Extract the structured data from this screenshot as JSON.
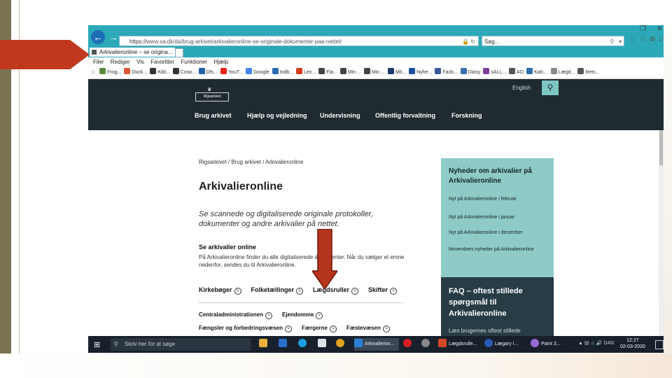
{
  "browser": {
    "url_protocol": "https://",
    "url_rest": "www.sa.dk/da/brug-arkivet/arkivalieronline-se-originale-dokumenter-paa-nettet/",
    "search_placeholder": "Søg...",
    "tab_title": "Arkivalieronline – se origina...",
    "menu": [
      "Filer",
      "Rediger",
      "Vis",
      "Favoritter",
      "Funktioner",
      "Hjælp"
    ],
    "favorites": [
      "Frog...",
      "Duck...",
      "Kild...",
      "Crow...",
      "Dfs...",
      "YouT...",
      "Google",
      "Indb...",
      "Lex...",
      "Fla...",
      "Min ...",
      "Min ...",
      "Mit...",
      "Nyhe...",
      "Facb...",
      "Daisy",
      "sALL...",
      "AO",
      "Kalc...",
      "Lægd...",
      "Rets..."
    ],
    "favorite_colors": [
      "#5a8a3a",
      "#de5833",
      "#333333",
      "#333333",
      "#1f5fa8",
      "#e62117",
      "#4285f4",
      "#2a6ab3",
      "#d83b1d",
      "#444444",
      "#444444",
      "#444444",
      "#1a3a6b",
      "#1d4ea3",
      "#3b5998",
      "#3a6fb0",
      "#7f3fa0",
      "#555555",
      "#2a6fb0",
      "#888888",
      "#555555"
    ]
  },
  "site": {
    "logo_text": "Rigsarkivet",
    "lang_link": "English",
    "nav": [
      "Brug arkivet",
      "Hjælp og vejledning",
      "Undervisning",
      "Offentlig forvaltning",
      "Forskning"
    ],
    "breadcrumb": "Rigsarkivet  /  Brug arkivet  /  Arkivalieronline",
    "title": "Arkivalieronline",
    "lead": "Se scannede og digitaliserede originale protokoller, dokumenter og andre arkivalier på nettet.",
    "section_heading": "Se arkivalier online",
    "section_text": "På Arkivalieronline finder du alle digitaliserede dokumenter. Når du vælger et emne nedenfor, sendes du til Arkivalieronline.",
    "links_row1": [
      "Kirkebøger",
      "Folketællinger",
      "Lægdsruller",
      "Skifter"
    ],
    "links_row2": [
      "Centraladministrationen",
      "Ejendomme"
    ],
    "links_row3": [
      "Fængsler og forbedringsvæsen",
      "Færgerne",
      "Fæstevæsen"
    ],
    "news_heading": "Nyheder om arkivalier på Arkivalieronline",
    "news_items": [
      "Nyt på Arkivalieronline i februar",
      "Nyt på Arkivalieronline i januar",
      "Nyt på Arkivalieronline i december",
      "Novembers nyheder på Arkivalieronline"
    ],
    "faq_heading": "FAQ – oftest stillede spørgsmål til Arkivalieronline",
    "faq_sub": "Læs brugernes oftest stillede"
  },
  "taskbar": {
    "search_placeholder": "Skriv her for at søge",
    "apps": [
      "Arkivalieron...",
      "Lægdsrulle...",
      "Lægary I...",
      "Paint 3..."
    ],
    "tray_lang": "DAN",
    "time": "12:27",
    "date": "02-03-2020"
  }
}
